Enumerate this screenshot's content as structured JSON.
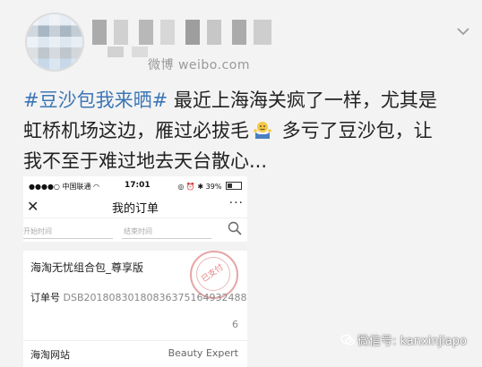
{
  "header": {
    "source": "微博 weibo.com"
  },
  "post": {
    "tag": "#豆沙包我来晒#",
    "line1_rest": " 最近上海海关疯了一样，尤其是",
    "line2": "虹桥机场这边，雁过必拔毛",
    "line2_rest": " 多亏了豆沙包，让",
    "line3": "我不至于难过地去天台散心..."
  },
  "phone": {
    "carrier": "中国联通",
    "time": "17:01",
    "battery": "39%",
    "title": "我的订单",
    "more": "···",
    "filter_start": "开始时间",
    "filter_end": "结束时间",
    "product_name": "海淘无忧组合包_尊享版",
    "order_label": "订单号",
    "order_number": "DSB20180830180836375164932488",
    "order_tail": "6",
    "stamp": "已支付",
    "shop_name": "海淘网站",
    "shop_right": "Beauty Expert"
  },
  "watermark": {
    "text": "微信号: kanxinjiapo"
  },
  "colors": {
    "tag": "#3c76b5",
    "background": "#f3f3f3"
  }
}
